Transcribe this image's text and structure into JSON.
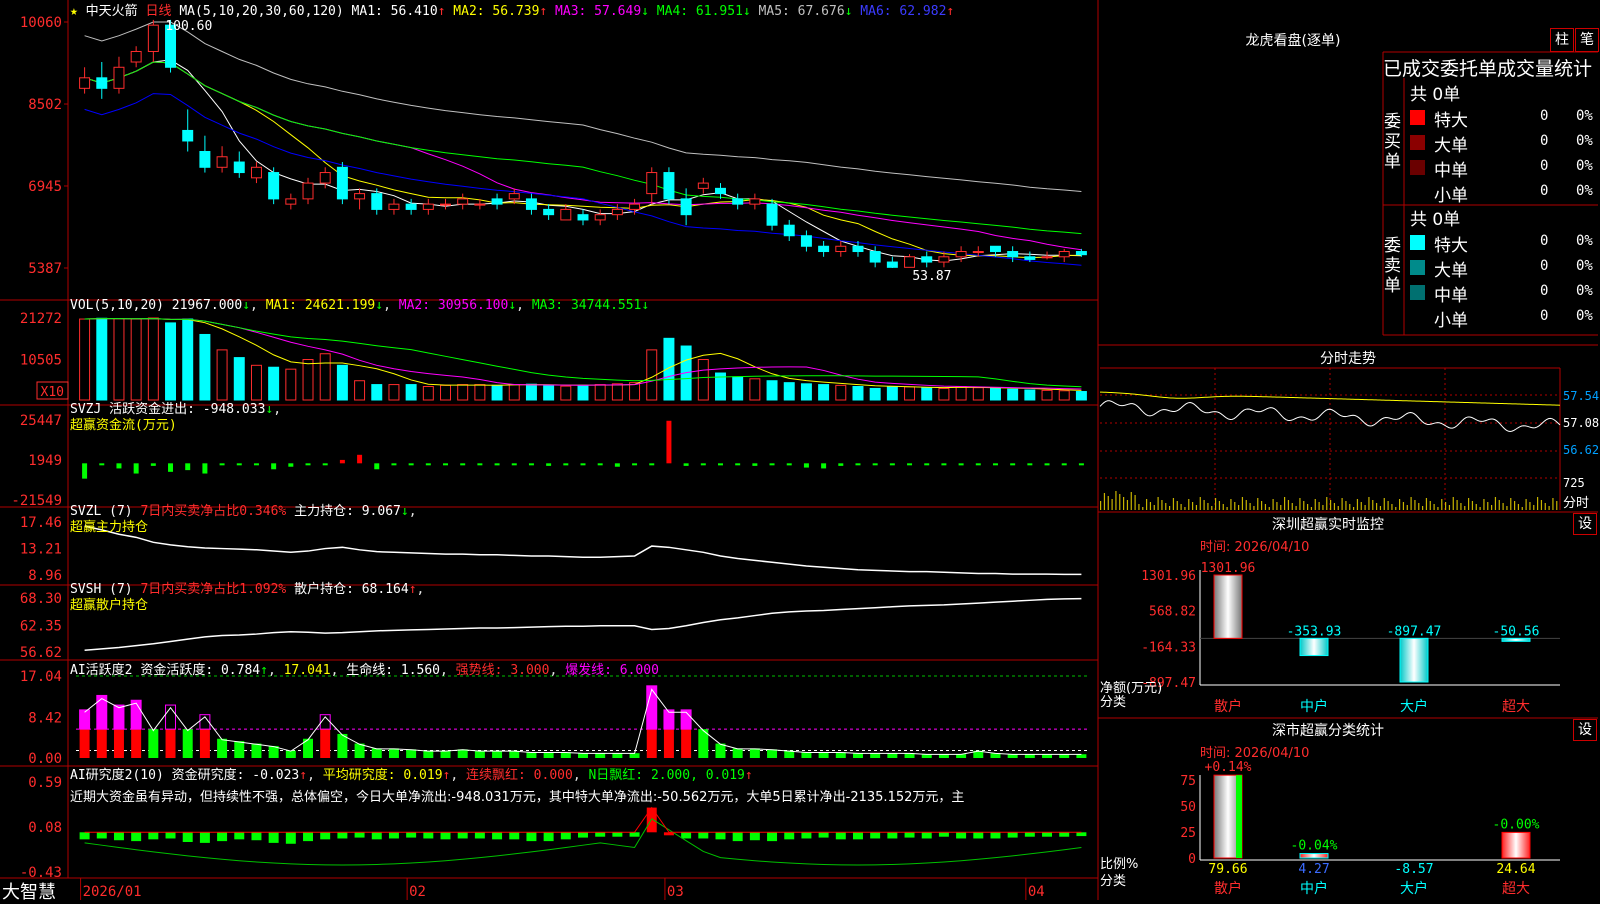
{
  "app": {
    "name": "大智慧",
    "stock": "中天火箭",
    "period": "日线"
  },
  "colors": {
    "up": "#ff2d2d",
    "down": "#00ffff",
    "grid": "#b00000",
    "ma": [
      "#ffffff",
      "#ffff00",
      "#ff00ff",
      "#00ff00",
      "#c0c0c0",
      "#0000ff"
    ]
  },
  "main": {
    "ma_title": "MA(5,10,20,30,60,120)",
    "ma_items": [
      {
        "label": "MA1: 56.410",
        "arrow": "↑"
      },
      {
        "label": "MA2: 56.739",
        "arrow": "↑"
      },
      {
        "label": "MA3: 57.649",
        "arrow": "↓"
      },
      {
        "label": "MA4: 61.951",
        "arrow": "↓"
      },
      {
        "label": "MA5: 67.676",
        "arrow": "↓"
      },
      {
        "label": "MA6: 62.982",
        "arrow": "↑"
      }
    ],
    "yticks": [
      "10060",
      "8502",
      "6945",
      "5387"
    ],
    "high_label": "100.60",
    "low_label": "53.87"
  },
  "vol": {
    "title": "VOL(5,10,20)",
    "value": "21967.000",
    "arrow0": "↓",
    "ma1": "MA1: 24621.199",
    "arrow1": "↓",
    "ma2": "MA2: 30956.100",
    "arrow2": "↓",
    "ma3": "MA3: 34744.551",
    "arrow3": "↓",
    "yticks": [
      "21272",
      "10505"
    ],
    "unit": "X10"
  },
  "svzj": {
    "title": "SVZJ",
    "label": "活跃资金进出: -948.033",
    "arrow": "↓",
    "sub": "超赢资金流(万元)",
    "yticks": [
      "25447",
      "1949",
      "-21549"
    ]
  },
  "svzl": {
    "title": "SVZL (7)",
    "red": "7日内买卖净占比0.346%",
    "label": "主力持仓: 9.067",
    "arrow": "↓",
    "sub": "超赢主力持仓",
    "yticks": [
      "17.46",
      "13.21",
      "8.96"
    ]
  },
  "svsh": {
    "title": "SVSH (7)",
    "red": "7日内买卖净占比1.092%",
    "label": "散户持仓: 68.164",
    "arrow": "↑",
    "sub": "超赢散户持仓",
    "yticks": [
      "68.30",
      "62.35",
      "56.62"
    ]
  },
  "ai1": {
    "title": "AI活跃度2",
    "label1": "资金活跃度: 0.784",
    "v2": "17.041",
    "label3": "生命线: 1.560",
    "label4": "强势线: 3.000",
    "label5": "爆发线: 6.000",
    "yticks": [
      "17.04",
      "8.42",
      "0.00"
    ]
  },
  "ai2": {
    "title": "AI研究度2(10)",
    "label1": "资金研究度: -0.023",
    "label2": "平均研究度: 0.019",
    "label3": "连续飘红: 0.000",
    "label4": "N日飘红: 2.000, 0.019",
    "yticks": [
      "0.59",
      "0.08",
      "-0.43"
    ],
    "comment": "近期大资金虽有异动，但持续性不强，总体偏空，今日大单净流出:-948.031万元，其中特大单净流出:-50.562万元，大单5日累计净出-2135.152万元，主"
  },
  "xaxis": [
    "2026/01",
    "02",
    "03",
    "04"
  ],
  "side": {
    "dragon_title": "龙虎看盘(逐单)",
    "btn1": "柱",
    "btn2": "笔",
    "stats_title": "已成交委托单成交量统计",
    "buy_label": "委买单",
    "sell_label": "委卖单",
    "buy_total": "共 0单",
    "sell_total": "共 0单",
    "buy_rows": [
      {
        "name": "特大",
        "n": "0",
        "p": "0%",
        "c": "#ff0000"
      },
      {
        "name": "大单",
        "n": "0",
        "p": "0%",
        "c": "#8b0000"
      },
      {
        "name": "中单",
        "n": "0",
        "p": "0%",
        "c": "#6a0000"
      },
      {
        "name": "小单",
        "n": "0",
        "p": "0%",
        "c": "#000000"
      }
    ],
    "sell_rows": [
      {
        "name": "特大",
        "n": "0",
        "p": "0%",
        "c": "#00ffff"
      },
      {
        "name": "大单",
        "n": "0",
        "p": "0%",
        "c": "#008b8b"
      },
      {
        "name": "中单",
        "n": "0",
        "p": "0%",
        "c": "#007070"
      },
      {
        "name": "小单",
        "n": "0",
        "p": "0%",
        "c": "#000000"
      }
    ],
    "intraday_title": "分时走势",
    "intraday_y": [
      "57.54",
      "57.08",
      "56.62"
    ],
    "intraday_vol": "725",
    "intraday_unit": "分时",
    "sz_title": "深圳超赢实时监控",
    "sz_btn": "设",
    "sz_time": "时间: 2026/04/10",
    "sz_yticks": [
      "1301.96",
      "568.82",
      "-164.33",
      "-897.47"
    ],
    "sz_bars": [
      {
        "cat": "散户",
        "label": "1301.96",
        "value": 1301.96
      },
      {
        "cat": "中户",
        "label": "-353.93",
        "value": -353.93
      },
      {
        "cat": "大户",
        "label": "-897.47",
        "value": -897.47
      },
      {
        "cat": "超大",
        "label": "-50.56",
        "value": -50.56
      }
    ],
    "sz_unit1": "净额(万元)",
    "sz_unit2": "分类",
    "cls_title": "深市超赢分类统计",
    "cls_btn": "设",
    "cls_time": "时间: 2026/04/10",
    "cls_yticks": [
      "75",
      "50",
      "25",
      "0"
    ],
    "cls_bars": [
      {
        "cat": "散户",
        "top": "+0.14%",
        "bottom": "79.66",
        "value": 79.66
      },
      {
        "cat": "中户",
        "top": "-0.04%",
        "bottom": "4.27",
        "value": 4.27
      },
      {
        "cat": "大户",
        "top": "",
        "bottom": "-8.57",
        "value": -8.57
      },
      {
        "cat": "超大",
        "top": "-0.00%",
        "bottom": "24.64",
        "value": 24.64
      }
    ],
    "cls_unit1": "比例%",
    "cls_unit2": "分类"
  },
  "chart_data": [
    {
      "type": "candlestick",
      "title": "中天火箭 日线",
      "ylim": [
        53.87,
        100.6
      ],
      "high": 100.6,
      "low": 53.87,
      "series": [
        {
          "name": "MA1",
          "value": 56.41
        },
        {
          "name": "MA2",
          "value": 56.739
        },
        {
          "name": "MA3",
          "value": 57.649
        },
        {
          "name": "MA4",
          "value": 61.951
        },
        {
          "name": "MA5",
          "value": 67.676
        },
        {
          "name": "MA6",
          "value": 62.982
        }
      ],
      "candles": [
        [
          88,
          90,
          87,
          92
        ],
        [
          90,
          88,
          86,
          93
        ],
        [
          88,
          92,
          87,
          94
        ],
        [
          93,
          95,
          92,
          96
        ],
        [
          95,
          100,
          93,
          101
        ],
        [
          100,
          92,
          91,
          101
        ],
        [
          80,
          78,
          76,
          84
        ],
        [
          76,
          73,
          72,
          79
        ],
        [
          73,
          75,
          72,
          77
        ],
        [
          74,
          72,
          71,
          76
        ],
        [
          71,
          73,
          70,
          74
        ],
        [
          72,
          67,
          66,
          73
        ],
        [
          66,
          67,
          65,
          68
        ],
        [
          67,
          70,
          66,
          71
        ],
        [
          70,
          72,
          69,
          73
        ],
        [
          73,
          67,
          66,
          74
        ],
        [
          67,
          68,
          65,
          69
        ],
        [
          68,
          65,
          64,
          69
        ],
        [
          65,
          66,
          64,
          67
        ],
        [
          66,
          65,
          64,
          67
        ],
        [
          65,
          66,
          64,
          67
        ],
        [
          66,
          66,
          65,
          67
        ],
        [
          66,
          67,
          65,
          68
        ],
        [
          66,
          66,
          65,
          67
        ],
        [
          67,
          66,
          65,
          68
        ],
        [
          67,
          68,
          66,
          69
        ],
        [
          67,
          65,
          64,
          68
        ],
        [
          65,
          64,
          63,
          66
        ],
        [
          63,
          65,
          63,
          66
        ],
        [
          64,
          63,
          62,
          65
        ],
        [
          63,
          64,
          62,
          65
        ],
        [
          64,
          65,
          63,
          66
        ],
        [
          65,
          66,
          64,
          67
        ],
        [
          68,
          72,
          66,
          73
        ],
        [
          72,
          67,
          66,
          73
        ],
        [
          67,
          64,
          62,
          69
        ],
        [
          69,
          70,
          68,
          71
        ],
        [
          69,
          68,
          67,
          70
        ],
        [
          67,
          66,
          65,
          68
        ],
        [
          66,
          67,
          65,
          68
        ],
        [
          66,
          62,
          61,
          67
        ],
        [
          62,
          60,
          59,
          63
        ],
        [
          60,
          58,
          57,
          61
        ],
        [
          58,
          57,
          56,
          59
        ],
        [
          57,
          58,
          56,
          59
        ],
        [
          58,
          57,
          56,
          59
        ],
        [
          57,
          55,
          54,
          58
        ],
        [
          55,
          54,
          53.87,
          56
        ],
        [
          54,
          56,
          54,
          56.5
        ],
        [
          56,
          55,
          54,
          57
        ],
        [
          55,
          56,
          54,
          57
        ],
        [
          56,
          57,
          55,
          58
        ],
        [
          57,
          57,
          56,
          58
        ],
        [
          58,
          57,
          56,
          58
        ],
        [
          57,
          56,
          55,
          58
        ],
        [
          56,
          55.5,
          55,
          57
        ],
        [
          56,
          56,
          55.5,
          57
        ],
        [
          56,
          57,
          55,
          57.5
        ],
        [
          57,
          56.4,
          56,
          57.5
        ]
      ]
    },
    {
      "type": "bar",
      "title": "VOL",
      "ylim": [
        0,
        21272
      ],
      "values": [
        21000,
        21200,
        21100,
        21000,
        21272,
        20000,
        21000,
        17000,
        13000,
        11000,
        9000,
        8500,
        8000,
        10500,
        12000,
        9000,
        5000,
        4000,
        4000,
        4000,
        3500,
        3800,
        4000,
        4000,
        3800,
        4000,
        4100,
        3800,
        3600,
        3800,
        4000,
        4200,
        4500,
        13000,
        16000,
        14000,
        10500,
        7000,
        6000,
        5500,
        5000,
        4500,
        4200,
        4000,
        3800,
        3500,
        3000,
        3500,
        3400,
        3200,
        3000,
        3500,
        3200,
        3000,
        2800,
        2600,
        2500,
        2400,
        2197
      ]
    },
    {
      "type": "bar",
      "title": "SVZJ",
      "ylim": [
        -21549,
        25447
      ],
      "values": [
        -9000,
        -1000,
        -3000,
        -6000,
        -1500,
        -5000,
        -4000,
        -6000,
        -1000,
        -800,
        -1000,
        -3500,
        -2000,
        -1000,
        -800,
        2000,
        5000,
        -3500,
        -1000,
        -1000,
        -800,
        -1000,
        -800,
        -600,
        -1200,
        -600,
        -800,
        -1500,
        -1200,
        -800,
        -1000,
        -2000,
        -1000,
        -600,
        25000,
        -1500,
        -800,
        -1200,
        -1000,
        -1500,
        -1000,
        -1200,
        -2500,
        -3000,
        -1500,
        -800,
        -1000,
        -800,
        -1000,
        -800,
        -1000,
        -1200,
        -800,
        -600,
        -800,
        -1000,
        -1200,
        -800,
        -948
      ]
    },
    {
      "type": "line",
      "title": "SVZL 主力持仓",
      "ylim": [
        8.96,
        17.46
      ],
      "values": [
        16.8,
        16.2,
        15.5,
        15.0,
        14.2,
        13.8,
        13.5,
        13.3,
        13.2,
        13.1,
        13.0,
        12.8,
        12.6,
        12.8,
        13.2,
        13.4,
        13.0,
        12.7,
        12.6,
        12.5,
        12.4,
        12.3,
        12.3,
        12.2,
        12.2,
        12.1,
        12.0,
        12.0,
        11.9,
        11.8,
        11.8,
        11.9,
        12.0,
        13.6,
        13.4,
        13.0,
        12.6,
        12.0,
        11.6,
        11.3,
        11.0,
        10.7,
        10.4,
        10.2,
        10.0,
        9.8,
        9.7,
        9.6,
        9.5,
        9.5,
        9.4,
        9.3,
        9.2,
        9.2,
        9.1,
        9.1,
        9.1,
        9.07,
        9.067
      ]
    },
    {
      "type": "line",
      "title": "SVSH 散户持仓",
      "ylim": [
        56.62,
        68.3
      ],
      "values": [
        57.0,
        57.3,
        57.6,
        58.0,
        58.4,
        58.9,
        59.4,
        59.9,
        60.2,
        60.3,
        60.5,
        60.8,
        61.0,
        60.9,
        60.7,
        60.8,
        61.0,
        61.2,
        61.3,
        61.4,
        61.5,
        61.6,
        61.7,
        61.8,
        61.8,
        61.9,
        62.0,
        62.1,
        62.2,
        62.2,
        62.3,
        62.3,
        62.3,
        61.5,
        61.7,
        62.3,
        63.0,
        63.6,
        64.0,
        64.5,
        65.0,
        65.3,
        65.5,
        65.6,
        65.8,
        66.0,
        66.2,
        66.4,
        66.6,
        66.7,
        66.8,
        67.0,
        67.2,
        67.4,
        67.6,
        67.8,
        68.0,
        68.1,
        68.164
      ]
    },
    {
      "type": "bar",
      "title": "AI活跃度2",
      "ylim": [
        0,
        17.04
      ],
      "values": [
        10,
        13,
        11,
        12,
        6,
        11,
        6,
        9,
        4,
        3.5,
        3,
        2.5,
        1.5,
        4,
        9,
        5,
        3,
        2,
        2,
        1.8,
        1.5,
        1.5,
        1.8,
        1.5,
        1.5,
        1.5,
        1.2,
        1.2,
        1.2,
        1.0,
        1.0,
        1.0,
        1.0,
        15,
        10,
        10,
        6,
        3,
        2,
        2,
        1.8,
        1.5,
        1.2,
        1.2,
        1.2,
        1.0,
        1.0,
        1.0,
        1.0,
        0.8,
        0.8,
        0.8,
        1.5,
        1.0,
        0.8,
        0.8,
        0.8,
        0.8,
        0.784
      ]
    },
    {
      "type": "bar",
      "title": "AI研究度2(10)",
      "ylim": [
        -0.43,
        0.59
      ],
      "values": [
        -0.06,
        -0.05,
        -0.07,
        -0.08,
        -0.06,
        -0.05,
        -0.09,
        -0.1,
        -0.08,
        -0.06,
        -0.07,
        -0.1,
        -0.11,
        -0.08,
        -0.06,
        -0.05,
        -0.04,
        -0.06,
        -0.05,
        -0.04,
        -0.05,
        -0.06,
        -0.05,
        -0.05,
        -0.06,
        -0.06,
        -0.08,
        -0.08,
        -0.06,
        -0.04,
        -0.03,
        -0.03,
        -0.03,
        0.3,
        0.02,
        -0.05,
        -0.05,
        -0.06,
        -0.08,
        -0.07,
        -0.08,
        -0.06,
        -0.05,
        -0.04,
        -0.06,
        -0.06,
        -0.05,
        -0.05,
        -0.04,
        -0.05,
        -0.03,
        -0.05,
        -0.05,
        -0.05,
        -0.04,
        -0.03,
        -0.03,
        -0.03,
        -0.023
      ]
    }
  ]
}
